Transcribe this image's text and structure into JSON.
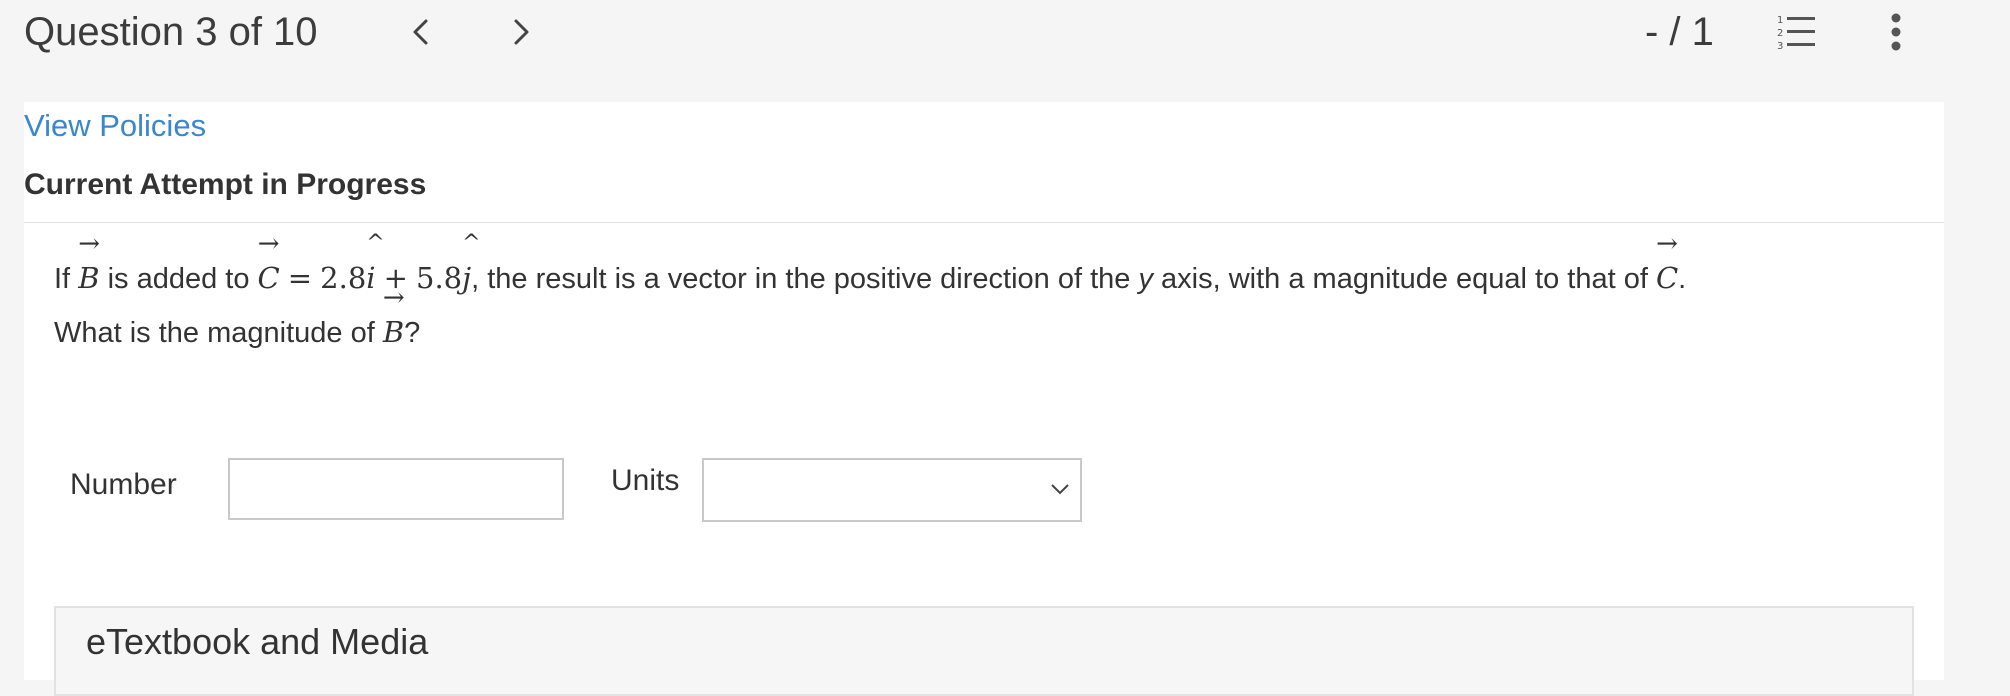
{
  "header": {
    "question_label": "Question 3 of 10",
    "score": "- / 1"
  },
  "links": {
    "view_policies": "View Policies"
  },
  "attempt": {
    "title": "Current Attempt in Progress"
  },
  "question": {
    "t_if": "If",
    "var_b": "B",
    "t_added_to": "is added to",
    "var_c": "C",
    "t_equals": "=",
    "coef_i": "2.8",
    "unit_i": "i",
    "t_plus": "+",
    "coef_j": "5.8",
    "unit_j": "j",
    "t_result": ", the result is a vector in the positive direction of the",
    "var_y": "y",
    "t_axis": "axis, with a magnitude equal to that of",
    "t_period": ".",
    "t_what": "What is the magnitude of",
    "t_qmark": "?"
  },
  "answer": {
    "number_label": "Number",
    "number_value": "",
    "units_label": "Units",
    "units_selected": ""
  },
  "resources": {
    "etextbook_title": "eTextbook and Media"
  },
  "icons": {
    "prev": "chevron-left-icon",
    "next": "chevron-right-icon",
    "list": "numbered-list-icon",
    "more": "more-vertical-icon",
    "dropdown": "chevron-down-icon"
  },
  "colors": {
    "link": "#3a87cf",
    "text": "#333333",
    "background": "#f5f5f5"
  }
}
